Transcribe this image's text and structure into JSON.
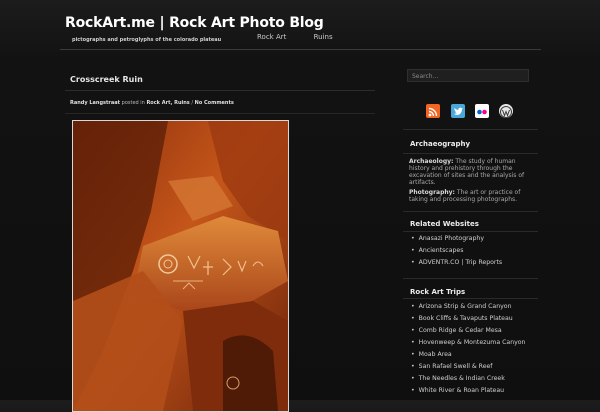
{
  "site": {
    "title": "RockArt.me | Rock Art Photo Blog",
    "tagline": "pictographs and petroglyphs of the colorado plateau"
  },
  "nav": {
    "items": [
      "Rock Art",
      "Ruins"
    ]
  },
  "post": {
    "title": "Crosscreek Ruin",
    "author": "Randy Langstraat",
    "posted_in_text": "posted in",
    "categories": "Rock Art, Ruins",
    "separator": "/",
    "comments": "No Comments"
  },
  "search": {
    "placeholder": "Search..."
  },
  "social_icons": [
    "rss-icon",
    "twitter-icon",
    "flickr-icon",
    "wordpress-icon"
  ],
  "colors": {
    "rss": "#f26522",
    "twitter": "#4aa7d8",
    "flickr_bg": "#ffffff",
    "flickr_blue": "#0063dc",
    "flickr_pink": "#ff0084",
    "wordpress": "#e8e8e8"
  },
  "sidebar": {
    "archaeography": {
      "heading": "Archaeography",
      "def1_term": "Archaeology:",
      "def1_text": " The study of human history and prehistory through the excavation of sites and the analysis of artifacts.",
      "def2_term": "Photography:",
      "def2_text": " The art or practice of taking and processing photographs."
    },
    "related": {
      "heading": "Related Websites",
      "items": [
        "Anasazi Photography",
        "Ancientscapes",
        "ADVENTR.CO | Trip Reports"
      ]
    },
    "trips": {
      "heading": "Rock Art Trips",
      "items": [
        "Arizona Strip & Grand Canyon",
        "Book Cliffs & Tavaputs Plateau",
        "Comb Ridge & Cedar Mesa",
        "Hovenweep & Montezuma Canyon",
        "Moab Area",
        "San Rafael Swell & Reef",
        "The Needles & Indian Creek",
        "White River & Roan Plateau"
      ]
    }
  }
}
